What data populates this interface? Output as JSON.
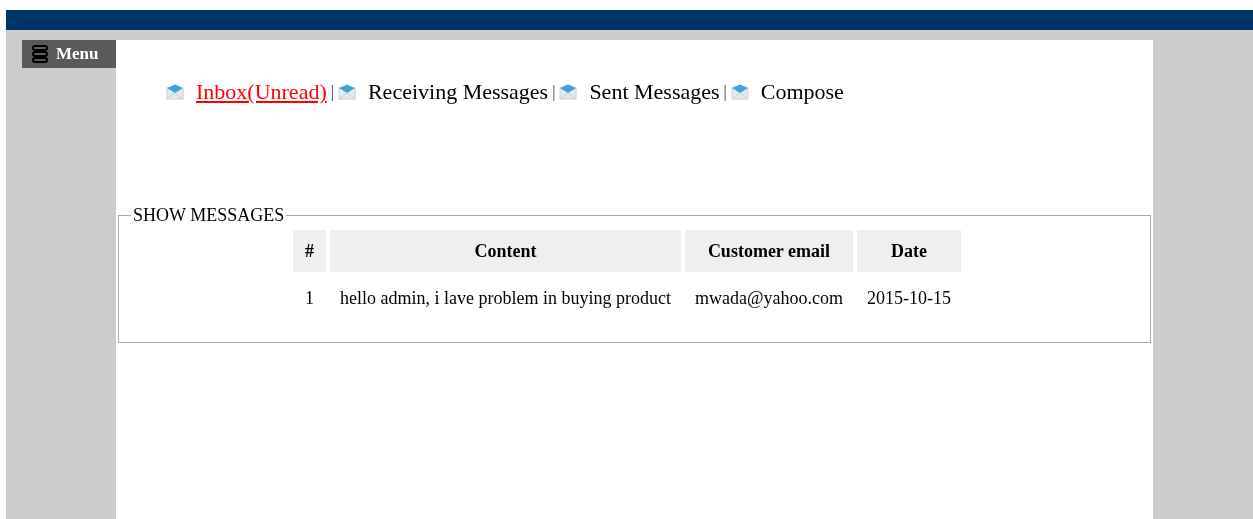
{
  "menu_button": {
    "label": "Menu"
  },
  "nav_links": [
    {
      "label": "Inbox(Unread)",
      "selected": true,
      "separator": "|"
    },
    {
      "label": "Receiving Messages",
      "selected": false,
      "separator": "|"
    },
    {
      "label": "Sent Messages",
      "selected": false,
      "separator": "|"
    },
    {
      "label": "Compose",
      "selected": false
    }
  ],
  "messages_panel": {
    "title": "SHOW MESSAGES",
    "table": {
      "columns": [
        "#",
        "Content",
        "Customer email",
        "Date"
      ],
      "rows": [
        [
          "1",
          "hello admin, i lave problem in buying product",
          "mwada@yahoo.com",
          "2015-10-15"
        ]
      ]
    }
  }
}
